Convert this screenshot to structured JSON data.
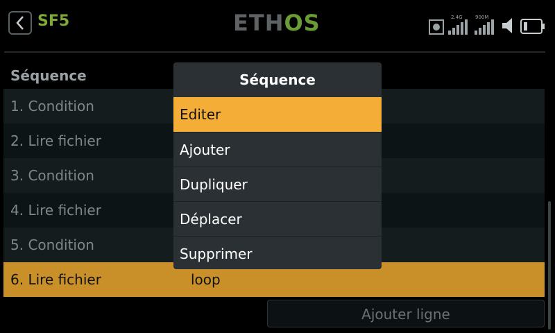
{
  "header": {
    "title": "SF5",
    "logo_left": "ETH",
    "logo_right": "OS",
    "status": {
      "band_24_label": "2.4G",
      "band_900_label": "900M",
      "icons": [
        "record-icon",
        "signal-24g-icon",
        "signal-900m-icon",
        "volume-icon",
        "battery-icon"
      ]
    }
  },
  "list": {
    "header": "Séquence",
    "rows": [
      {
        "label": "1. Condition",
        "value": ""
      },
      {
        "label": "2. Lire fichier",
        "value": ""
      },
      {
        "label": "3. Condition",
        "value": ""
      },
      {
        "label": "4. Lire fichier",
        "value": ""
      },
      {
        "label": "5. Condition",
        "value": ""
      },
      {
        "label": "6. Lire fichier",
        "value": "loop"
      }
    ],
    "selected_index": 5
  },
  "add_line_label": "Ajouter ligne",
  "popup": {
    "title": "Séquence",
    "items": [
      "Editer",
      "Ajouter",
      "Dupliquer",
      "Déplacer",
      "Supprimer"
    ],
    "active_index": 0
  },
  "colors": {
    "accent": "#f4ad36",
    "selected_row": "#c9902a",
    "title_green": "#7fa83a"
  }
}
